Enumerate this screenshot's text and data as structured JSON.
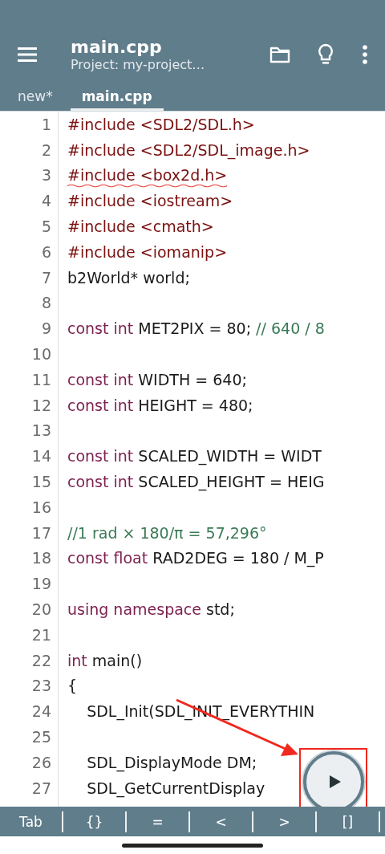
{
  "app_bar": {
    "title": "main.cpp",
    "subtitle": "Project: my-project…"
  },
  "tabs": [
    {
      "label": "new*",
      "selected": false
    },
    {
      "label": "main.cpp",
      "selected": true
    }
  ],
  "code_lines": [
    {
      "number": "1",
      "tokens": [
        {
          "kind": "preproc",
          "text": "#include <SDL2/SDL.h>"
        }
      ],
      "error": false
    },
    {
      "number": "2",
      "tokens": [
        {
          "kind": "preproc",
          "text": "#include <SDL2/SDL_image.h>"
        }
      ],
      "error": false
    },
    {
      "number": "3",
      "tokens": [
        {
          "kind": "preproc",
          "text": "#include <box2d.h>"
        }
      ],
      "error": true
    },
    {
      "number": "4",
      "tokens": [
        {
          "kind": "preproc",
          "text": "#include <iostream>"
        }
      ],
      "error": false
    },
    {
      "number": "5",
      "tokens": [
        {
          "kind": "preproc",
          "text": "#include <cmath>"
        }
      ],
      "error": false
    },
    {
      "number": "6",
      "tokens": [
        {
          "kind": "preproc",
          "text": "#include <iomanip>"
        }
      ],
      "error": false
    },
    {
      "number": "7",
      "tokens": [
        {
          "kind": "plain",
          "text": "b2World* world;"
        }
      ],
      "error": false
    },
    {
      "number": "8"
    },
    {
      "number": "9",
      "tokens": [
        {
          "kind": "keyword",
          "text": "const int"
        },
        {
          "kind": "plain",
          "text": " MET2PIX = 80; "
        },
        {
          "kind": "comment",
          "text": "// 640 / 8"
        }
      ],
      "error": false
    },
    {
      "number": "10"
    },
    {
      "number": "11",
      "tokens": [
        {
          "kind": "keyword",
          "text": "const int"
        },
        {
          "kind": "plain",
          "text": " WIDTH = 640;"
        }
      ],
      "error": false
    },
    {
      "number": "12",
      "tokens": [
        {
          "kind": "keyword",
          "text": "const int"
        },
        {
          "kind": "plain",
          "text": " HEIGHT = 480;"
        }
      ],
      "error": false
    },
    {
      "number": "13"
    },
    {
      "number": "14",
      "tokens": [
        {
          "kind": "keyword",
          "text": "const int"
        },
        {
          "kind": "plain",
          "text": " SCALED_WIDTH = WIDT"
        }
      ],
      "error": false
    },
    {
      "number": "15",
      "tokens": [
        {
          "kind": "keyword",
          "text": "const int"
        },
        {
          "kind": "plain",
          "text": " SCALED_HEIGHT = HEIG"
        }
      ],
      "error": false
    },
    {
      "number": "16"
    },
    {
      "number": "17",
      "tokens": [
        {
          "kind": "comment",
          "text": "//1 rad × 180/π = 57,296°"
        }
      ],
      "error": false
    },
    {
      "number": "18",
      "tokens": [
        {
          "kind": "keyword",
          "text": "const float"
        },
        {
          "kind": "plain",
          "text": " RAD2DEG = 180 / M_P"
        }
      ],
      "error": false
    },
    {
      "number": "19"
    },
    {
      "number": "20",
      "tokens": [
        {
          "kind": "keyword",
          "text": "using namespace"
        },
        {
          "kind": "plain",
          "text": " std;"
        }
      ],
      "error": false
    },
    {
      "number": "21"
    },
    {
      "number": "22",
      "tokens": [
        {
          "kind": "keyword",
          "text": "int"
        },
        {
          "kind": "plain",
          "text": " main()"
        }
      ],
      "error": false
    },
    {
      "number": "23",
      "tokens": [
        {
          "kind": "plain",
          "text": "{"
        }
      ],
      "error": false
    },
    {
      "number": "24",
      "tokens": [
        {
          "kind": "plain",
          "text": "    SDL_Init(SDL_INIT_EVERYTHIN"
        }
      ],
      "error": false
    },
    {
      "number": "25"
    },
    {
      "number": "26",
      "tokens": [
        {
          "kind": "plain",
          "text": "    SDL_DisplayMode DM;"
        }
      ],
      "error": false
    },
    {
      "number": "27",
      "tokens": [
        {
          "kind": "plain",
          "text": "    SDL_GetCurrentDisplay"
        }
      ],
      "error": false
    }
  ],
  "keys": [
    "Tab",
    "{}",
    "=",
    "<",
    ">",
    "[]"
  ]
}
